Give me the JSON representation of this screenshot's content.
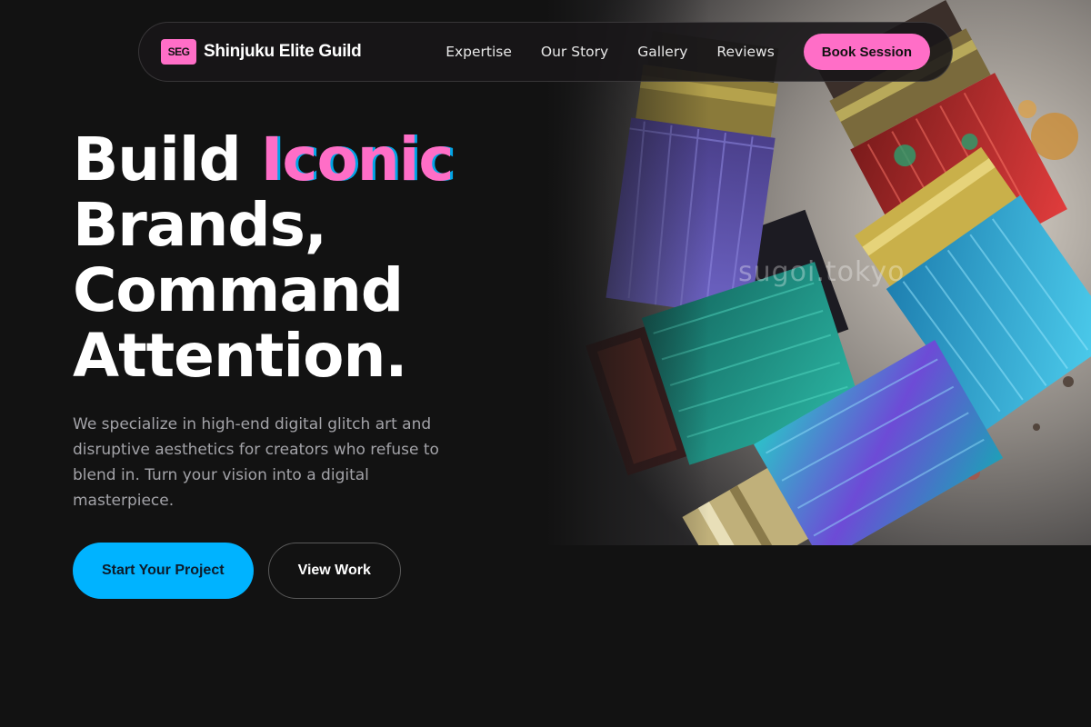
{
  "brand": {
    "badge": "SEG",
    "name": "Shinjuku Elite Guild",
    "accent_color": "#ff6ec7"
  },
  "nav": {
    "links": [
      "Expertise",
      "Our Story",
      "Gallery",
      "Reviews"
    ],
    "cta_label": "Book Session"
  },
  "hero": {
    "headline_word1": "Build ",
    "headline_accent": "Iconic",
    "headline_line2": "Brands,",
    "headline_line3": "Command",
    "headline_line4": "Attention.",
    "description": "We specialize in high-end digital glitch art and disruptive aesthetics for creators who refuse to blend in. Turn your vision into a digital masterpiece.",
    "primary_cta": "Start Your Project",
    "secondary_cta": "View Work",
    "primary_color": "#00b3ff"
  },
  "image": {
    "subject": "paint-brushes-photo",
    "watermark": "sugoi.tokyo"
  }
}
